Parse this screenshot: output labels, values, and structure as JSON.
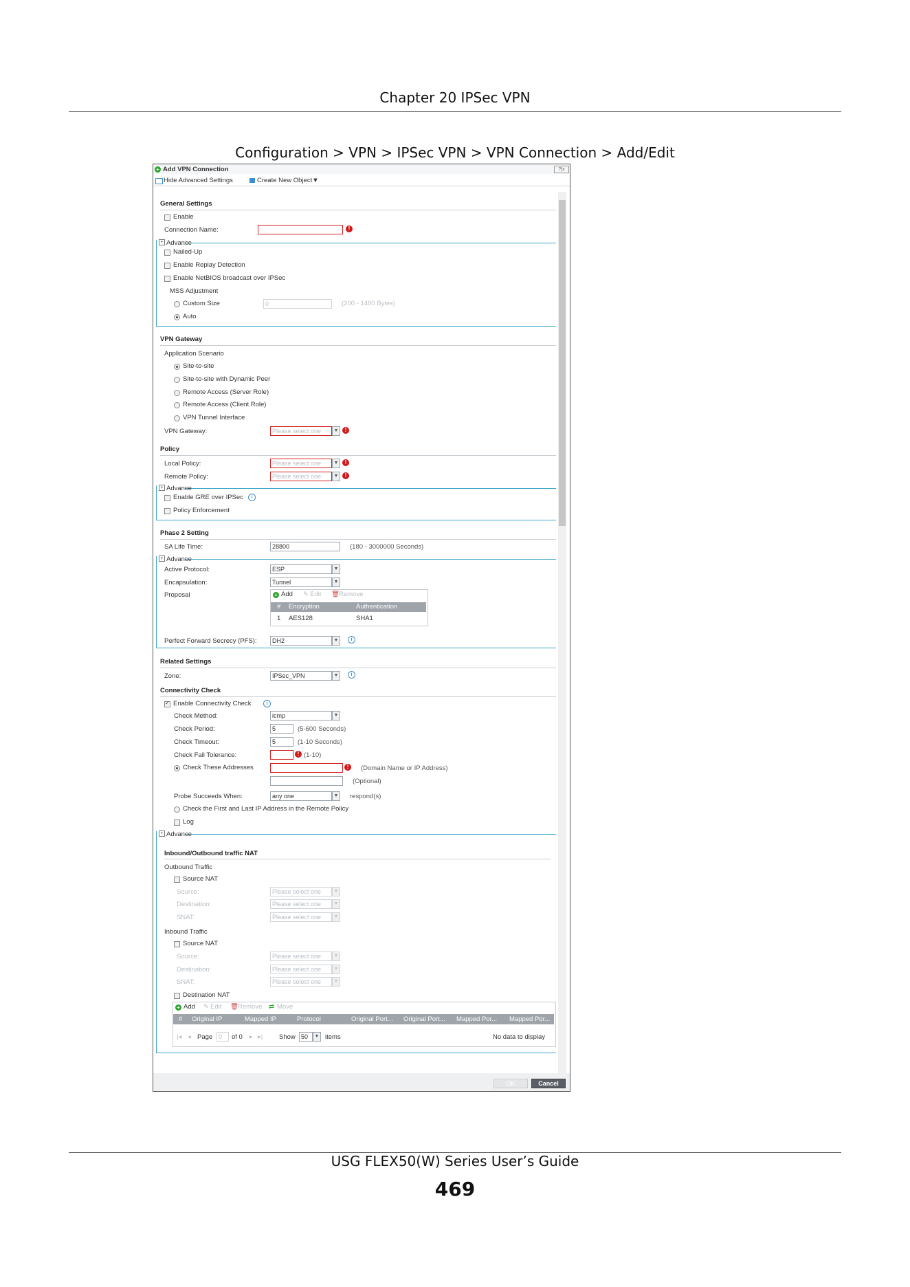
{
  "page": {
    "chapter": "Chapter 20 IPSec VPN",
    "caption": "Configuration > VPN > IPSec VPN > VPN Connection > Add/Edit",
    "footer": "USG FLEX50(W) Series User’s Guide",
    "page_number": "469"
  },
  "dialog": {
    "title": "Add VPN Connection",
    "help_icons": "?|x",
    "toolbar": {
      "hide_advanced": "Hide Advanced Settings",
      "create_object": "Create New Object▼"
    },
    "general": {
      "heading": "General Settings",
      "enable": "Enable",
      "connection_name_label": "Connection Name:",
      "advance": "Advance",
      "nailed_up": "Nailed-Up",
      "replay": "Enable Replay Detection",
      "netbios": "Enable NetBIOS broadcast over IPSec",
      "mss": "MSS Adjustment",
      "custom_size": "Custom Size",
      "custom_value": "0",
      "custom_hint": "(200 - 1460 Bytes)",
      "auto": "Auto"
    },
    "gateway": {
      "heading": "VPN Gateway",
      "app_scenario": "Application Scenario",
      "options": [
        "Site-to-site",
        "Site-to-site with Dynamic Peer",
        "Remote Access (Server Role)",
        "Remote Access (Client Role)",
        "VPN Tunnel Interface"
      ],
      "gateway_label": "VPN Gateway:",
      "placeholder": "Please select one"
    },
    "policy": {
      "heading": "Policy",
      "local": "Local Policy:",
      "remote": "Remote Policy:",
      "placeholder": "Please select one",
      "advance": "Advance",
      "gre": "Enable GRE over IPSec",
      "enforcement": "Policy Enforcement"
    },
    "phase2": {
      "heading": "Phase 2 Setting",
      "sa_label": "SA Life Time:",
      "sa_value": "28800",
      "sa_hint": "(180 - 3000000 Seconds)",
      "advance": "Advance",
      "protocol_label": "Active Protocol:",
      "protocol_value": "ESP",
      "encap_label": "Encapsulation:",
      "encap_value": "Tunnel",
      "proposal_label": "Proposal",
      "proposal_add": "Add",
      "proposal_edit": "Edit",
      "proposal_remove": "Remove",
      "proposal_cols": [
        "#",
        "Encryption",
        "Authentication"
      ],
      "proposal_row": [
        "1",
        "AES128",
        "SHA1"
      ],
      "pfs_label": "Perfect Forward Secrecy (PFS):",
      "pfs_value": "DH2"
    },
    "related": {
      "heading": "Related Settings",
      "zone_label": "Zone:",
      "zone_value": "IPSec_VPN"
    },
    "conn": {
      "heading": "Connectivity Check",
      "enable": "Enable Connectivity Check",
      "method_label": "Check Method:",
      "method_value": "icmp",
      "period_label": "Check Period:",
      "period_value": "5",
      "period_hint": "(5-600 Seconds)",
      "timeout_label": "Check Timeout:",
      "timeout_value": "5",
      "timeout_hint": "(1-10 Seconds)",
      "fail_label": "Check Fail Tolerance:",
      "fail_hint": "(1-10)",
      "addresses_label": "Check These Addresses",
      "addresses_hint": "(Domain Name or IP Address)",
      "optional_hint": "(Optional)",
      "probe_label": "Probe Succeeds When:",
      "probe_value": "any one",
      "probe_hint": "respond(s)",
      "first_last": "Check the First and Last IP Address in the Remote Policy",
      "log": "Log",
      "advance": "Advance"
    },
    "nat": {
      "heading": "Inbound/Outbound traffic NAT",
      "outbound": "Outbound Traffic",
      "inbound": "Inbound Traffic",
      "source_nat": "Source NAT",
      "source": "Source:",
      "destination": "Destination:",
      "snat": "SNAT:",
      "placeholder": "Please select one",
      "destination_nat": "Destination NAT",
      "grid_add": "Add",
      "grid_edit": "Edit",
      "grid_remove": "Remove",
      "grid_move": "Move",
      "grid_cols": [
        "#",
        "Original IP",
        "Mapped IP",
        "Protocol",
        "Original Port...",
        "Original Port...",
        "Mapped Por...",
        "Mapped Por..."
      ],
      "pager_page": "Page",
      "pager_page_value": "0",
      "pager_of": "of 0",
      "pager_show": "Show",
      "pager_show_value": "50",
      "pager_items": "items",
      "no_data": "No data to display"
    },
    "buttons": {
      "ok": "OK",
      "cancel": "Cancel"
    }
  }
}
